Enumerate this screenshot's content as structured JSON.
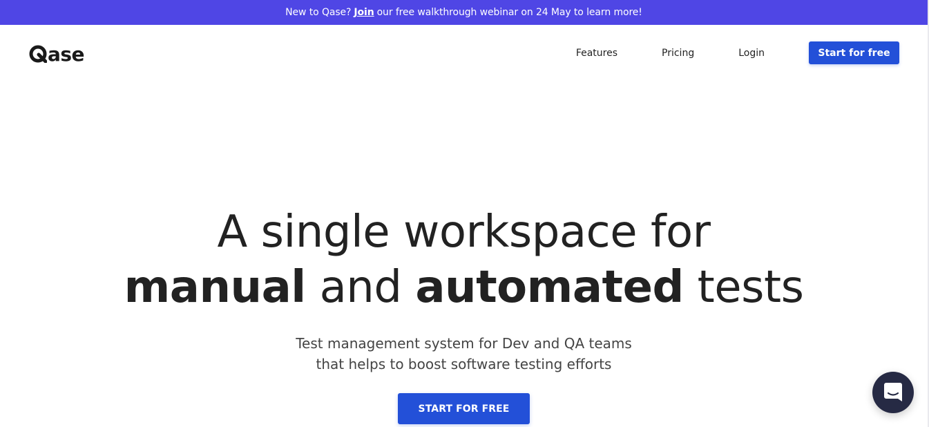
{
  "announcement": {
    "prefix": "New to Qase?",
    "link": "Join",
    "suffix": "our free walkthrough webinar on 24 May to learn more!"
  },
  "header": {
    "logo_text": "ase",
    "nav": {
      "features": "Features",
      "pricing": "Pricing",
      "login": "Login",
      "cta": "Start for free"
    }
  },
  "hero": {
    "line1": "A single workspace for",
    "bold1": "manual",
    "mid": " and ",
    "bold2": "automated",
    "end": " tests",
    "sub1": "Test management system for Dev and QA teams",
    "sub2": "that helps to boost software testing efforts",
    "cta": "START FOR FREE"
  },
  "colors": {
    "brand": "#4f46e5",
    "button": "#2350d8",
    "chat": "#262a44"
  },
  "icons": {
    "logo": "qase-q-icon",
    "chat": "chat-bubble-icon"
  }
}
